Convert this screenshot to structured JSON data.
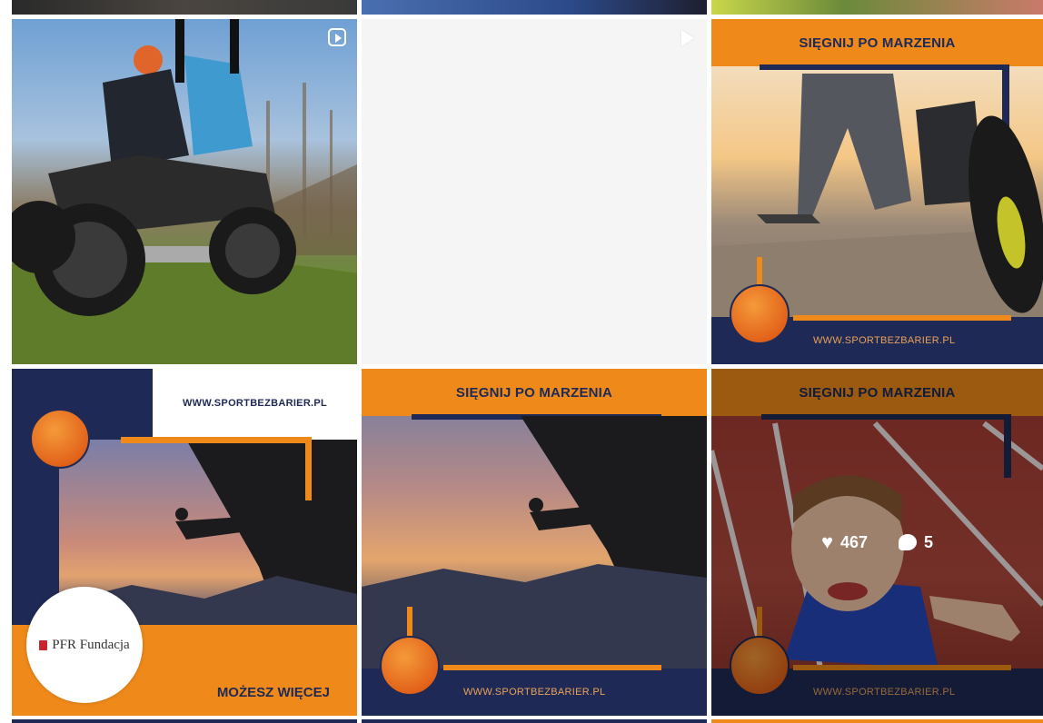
{
  "grid": {
    "tiles": [
      {
        "id": "wheelchair-offroad",
        "type": "reel"
      },
      {
        "id": "blank-loading",
        "type": "video"
      },
      {
        "id": "runner-prosthesis",
        "banner": "SIĘGNIJ PO MARZENIA",
        "url": "WWW.SPORTBEZBARIER.PL"
      },
      {
        "id": "climber-pfr",
        "url": "WWW.SPORTBEZBARIER.PL",
        "partner": "PFR Fundacja",
        "tagline": "MOŻESZ WIĘCEJ"
      },
      {
        "id": "climber-banner",
        "banner": "SIĘGNIJ PO MARZENIA",
        "url": "WWW.SPORTBEZBARIER.PL"
      },
      {
        "id": "girl-track",
        "banner": "SIĘGNIJ PO MARZENIA",
        "url": "WWW.SPORTBEZBARIER.PL",
        "likes": "467",
        "comments": "5"
      }
    ]
  },
  "icons": {
    "reel": "reel-icon",
    "video": "play-icon",
    "like": "heart-icon",
    "comment": "comment-icon",
    "logo": "wheelchair-athlete-logo"
  },
  "colors": {
    "orange": "#ef8a1a",
    "navy": "#1e2a55",
    "hover_overlay": "rgba(0,0,0,0.35)"
  }
}
